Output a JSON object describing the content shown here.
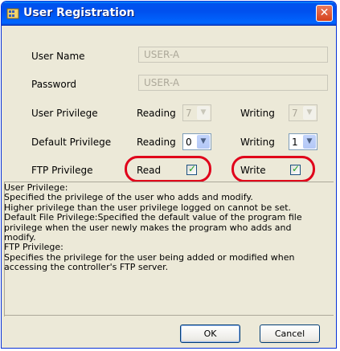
{
  "window": {
    "title": "User Registration",
    "close_glyph": "✕"
  },
  "fields": {
    "user_name": {
      "label": "User Name",
      "value": "USER-A"
    },
    "password": {
      "label": "Password",
      "value": "USER-A"
    }
  },
  "user_privilege": {
    "label": "User Privilege",
    "reading_label": "Reading",
    "reading_value": "7",
    "writing_label": "Writing",
    "writing_value": "7"
  },
  "default_privilege": {
    "label": "Default Privilege",
    "reading_label": "Reading",
    "reading_value": "0",
    "writing_label": "Writing",
    "writing_value": "1"
  },
  "ftp_privilege": {
    "label": "FTP Privilege",
    "read_label": "Read",
    "read_checked": true,
    "write_label": "Write",
    "write_checked": true
  },
  "description": "User Privilege:\nSpecified the privilege of the user who adds and modify.\nHigher privilege than the user privilege logged on cannot be set.\nDefault File Privilege:Specified the default value of the program file\nprivilege when the user newly makes the program who adds and\nmodify.\nFTP Privilege:\nSpecifies the privilege for the user being added or modified when\naccessing the controller's FTP server.",
  "buttons": {
    "ok": "OK",
    "cancel": "Cancel"
  },
  "colors": {
    "highlight_oval": "#e0001a",
    "title_bar": "#0050ee"
  }
}
